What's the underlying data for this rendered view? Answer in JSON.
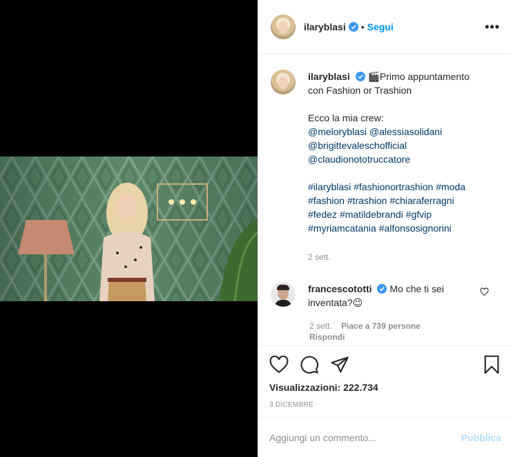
{
  "post": {
    "username": "ilaryblasi",
    "follow_label": "Segui",
    "dot": "•",
    "more_label": "•••"
  },
  "caption": {
    "username": "ilaryblasi",
    "emoji": "🎬",
    "line1": "Primo appuntamento con Fashion or Trashion",
    "crew_intro": "Ecco la mia crew:",
    "mentions": [
      "@meloryblasi",
      "@alessiasolidani",
      "@brigittevaleschofficial",
      "@claudionototruccatore"
    ],
    "hashtags": [
      "#ilaryblasi",
      "#fashionortrashion",
      "#moda",
      "#fashion",
      "#trashion",
      "#chiaraferragni",
      "#fedez",
      "#matildebrandi",
      "#gfvip",
      "#myriamcatania",
      "#alfonsosignorini"
    ],
    "time": "2 sett."
  },
  "reply": {
    "username": "francescototti",
    "text": "Mo che ti sei inventata?",
    "emoji": "😉",
    "time": "2 sett.",
    "likes": "Piace a 739 persone",
    "reply_label": "Rispondi"
  },
  "stats": {
    "views": "Visualizzazioni: 222.734",
    "date": "3 DICEMBRE"
  },
  "compose": {
    "placeholder": "Aggiungi un commento...",
    "publish_label": "Pubblica"
  },
  "colors": {
    "accent": "#0095f6",
    "wallpaper": "#5e8a6b",
    "publish_disabled": "#b2dffc"
  }
}
